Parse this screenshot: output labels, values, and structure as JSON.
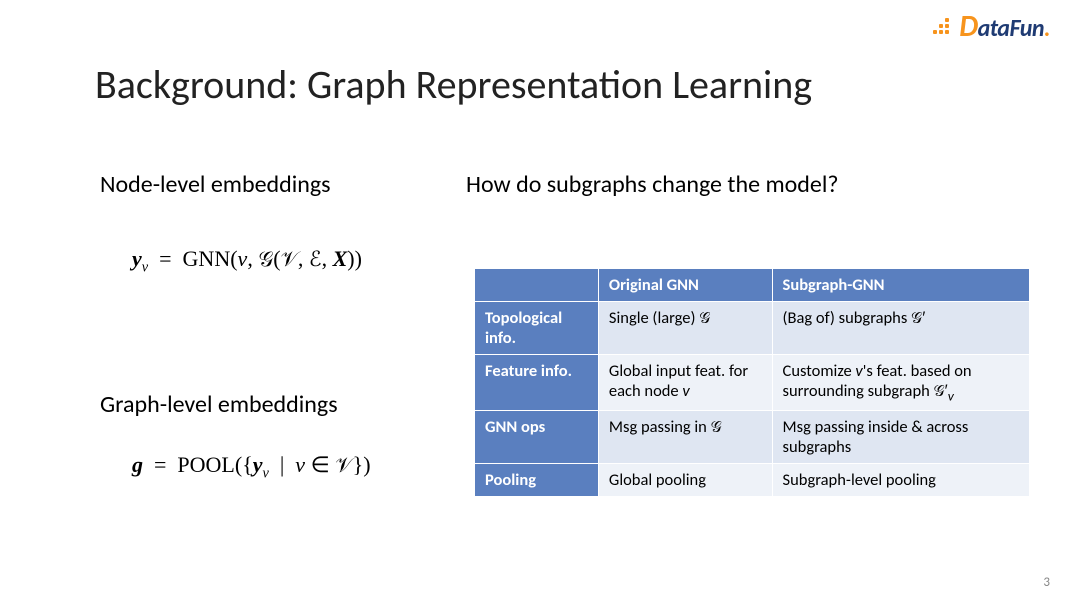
{
  "logo": {
    "text_d": "D",
    "text_rest": "ataFun",
    "text_dot": "."
  },
  "title": "Background: Graph Representation Learning",
  "subheadings": {
    "node": "Node-level embeddings",
    "graph": "Graph-level embeddings",
    "subgraph_q": "How do subgraphs change the model?"
  },
  "equations": {
    "node_html": "<span class='bi'>y</span><sub><span class='it'>v</span></sub> &nbsp;=&nbsp; <span class='up'>GNN</span>(<span class='it'>v</span>, <span class='scr'>𝒢</span>(<span class='scr'>𝒱</span>, <span class='scr'>ℰ</span>, <span class='bi'>X</span>))",
    "graph_html": "<span class='bi'>g</span> &nbsp;=&nbsp; <span class='up'>POOL</span>({<span class='bi'>y</span><sub><span class='it'>v</span></sub> &nbsp;|&nbsp; <span class='it'>v</span> ∈ <span class='scr'>𝒱</span>})"
  },
  "table": {
    "headers": {
      "col2": "Original GNN",
      "col3": "Subgraph-GNN"
    },
    "rows": [
      {
        "label": "Topological info.",
        "col2_html": "Single (large) <span class='scr'>𝒢</span>",
        "col3_html": "(Bag of) subgraphs <span class='scr'>𝒢</span>′"
      },
      {
        "label": "Feature info.",
        "col2_html": "Global input feat. for each node <span class='it'>v</span>",
        "col3_html": "Customize <span class='it'>v</span>'s feat. based on surrounding subgraph <span class='scr'>𝒢</span>′<sub><span class='it'>v</span></sub>"
      },
      {
        "label": "GNN ops",
        "col2_html": "Msg passing in <span class='scr'>𝒢</span>",
        "col3_html": "Msg passing inside &amp; across subgraphs"
      },
      {
        "label": "Pooling",
        "col2_html": "Global pooling",
        "col3_html": "Subgraph-level pooling"
      }
    ]
  },
  "page_number": "3"
}
